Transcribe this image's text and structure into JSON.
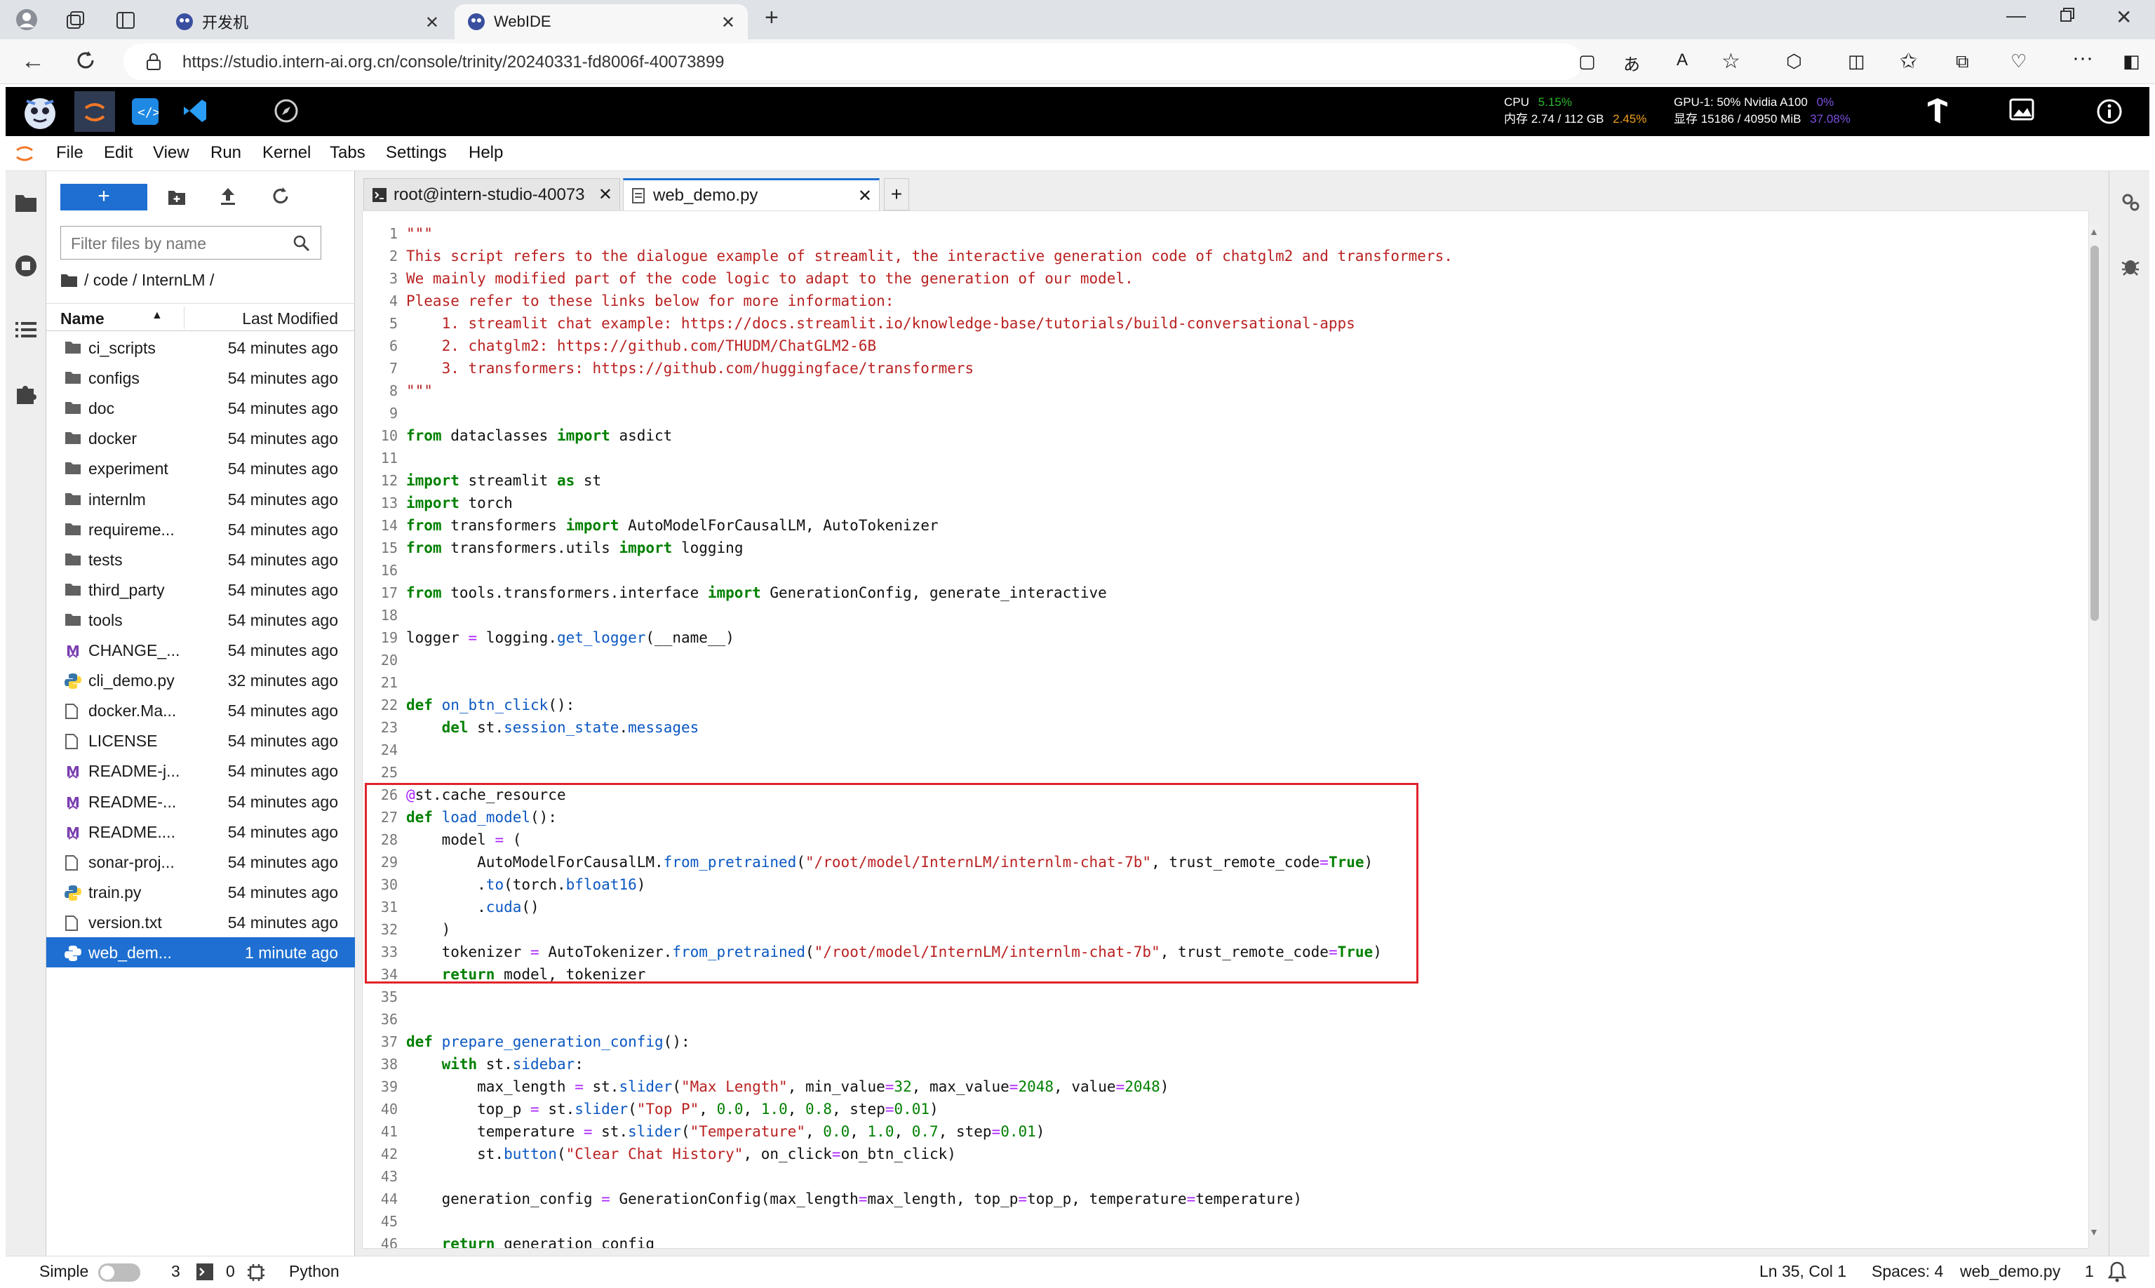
{
  "browser": {
    "tabs": [
      {
        "title": "开发机",
        "active": false
      },
      {
        "title": "WebIDE",
        "active": true
      }
    ],
    "new_tab": "+",
    "url": "https://studio.intern-ai.org.cn/console/trinity/20240331-fd8006f-40073899"
  },
  "topbar": {
    "cpu_label": "CPU",
    "cpu_value": "5.15%",
    "mem_label": "内存 2.74 / 112 GB",
    "mem_value": "2.45%",
    "gpu_label": "GPU-1: 50% Nvidia A100",
    "gpu_value": "0%",
    "vram_label": "显存 15186 / 40950 MiB",
    "vram_value": "37.08%"
  },
  "menu": [
    "File",
    "Edit",
    "View",
    "Run",
    "Kernel",
    "Tabs",
    "Settings",
    "Help"
  ],
  "filebrowser": {
    "new_label": "+",
    "filter_placeholder": "Filter files by name",
    "breadcrumb": "/ code / InternLM /",
    "col_name": "Name",
    "col_modified": "Last Modified",
    "files": [
      {
        "name": "ci_scripts",
        "time": "54 minutes ago",
        "kind": "folder"
      },
      {
        "name": "configs",
        "time": "54 minutes ago",
        "kind": "folder"
      },
      {
        "name": "doc",
        "time": "54 minutes ago",
        "kind": "folder"
      },
      {
        "name": "docker",
        "time": "54 minutes ago",
        "kind": "folder"
      },
      {
        "name": "experiment",
        "time": "54 minutes ago",
        "kind": "folder"
      },
      {
        "name": "internlm",
        "time": "54 minutes ago",
        "kind": "folder"
      },
      {
        "name": "requireme...",
        "time": "54 minutes ago",
        "kind": "folder"
      },
      {
        "name": "tests",
        "time": "54 minutes ago",
        "kind": "folder"
      },
      {
        "name": "third_party",
        "time": "54 minutes ago",
        "kind": "folder"
      },
      {
        "name": "tools",
        "time": "54 minutes ago",
        "kind": "folder"
      },
      {
        "name": "CHANGE_...",
        "time": "54 minutes ago",
        "kind": "md"
      },
      {
        "name": "cli_demo.py",
        "time": "32 minutes ago",
        "kind": "py"
      },
      {
        "name": "docker.Ma...",
        "time": "54 minutes ago",
        "kind": "file"
      },
      {
        "name": "LICENSE",
        "time": "54 minutes ago",
        "kind": "file"
      },
      {
        "name": "README-j...",
        "time": "54 minutes ago",
        "kind": "md"
      },
      {
        "name": "README-...",
        "time": "54 minutes ago",
        "kind": "md"
      },
      {
        "name": "README....",
        "time": "54 minutes ago",
        "kind": "md"
      },
      {
        "name": "sonar-proj...",
        "time": "54 minutes ago",
        "kind": "file"
      },
      {
        "name": "train.py",
        "time": "54 minutes ago",
        "kind": "py"
      },
      {
        "name": "version.txt",
        "time": "54 minutes ago",
        "kind": "file"
      },
      {
        "name": "web_dem...",
        "time": "1 minute ago",
        "kind": "py",
        "selected": true
      }
    ]
  },
  "editor": {
    "tabs": [
      {
        "title": "root@intern-studio-40073",
        "active": false
      },
      {
        "title": "web_demo.py",
        "active": true
      }
    ],
    "add_tab": "+"
  },
  "status": {
    "mode": "Simple",
    "terminals": "3",
    "kernels": "0",
    "language": "Python",
    "cursor": "Ln 35, Col 1",
    "spaces": "Spaces: 4",
    "file": "web_demo.py",
    "notifications": "1"
  },
  "colors": {
    "accent": "#1e6fd1",
    "highlight_box": "#e0242c",
    "cpu_green": "#2db52d",
    "gpu_purple": "#7b4fe0",
    "mem_orange": "#f0a020"
  }
}
